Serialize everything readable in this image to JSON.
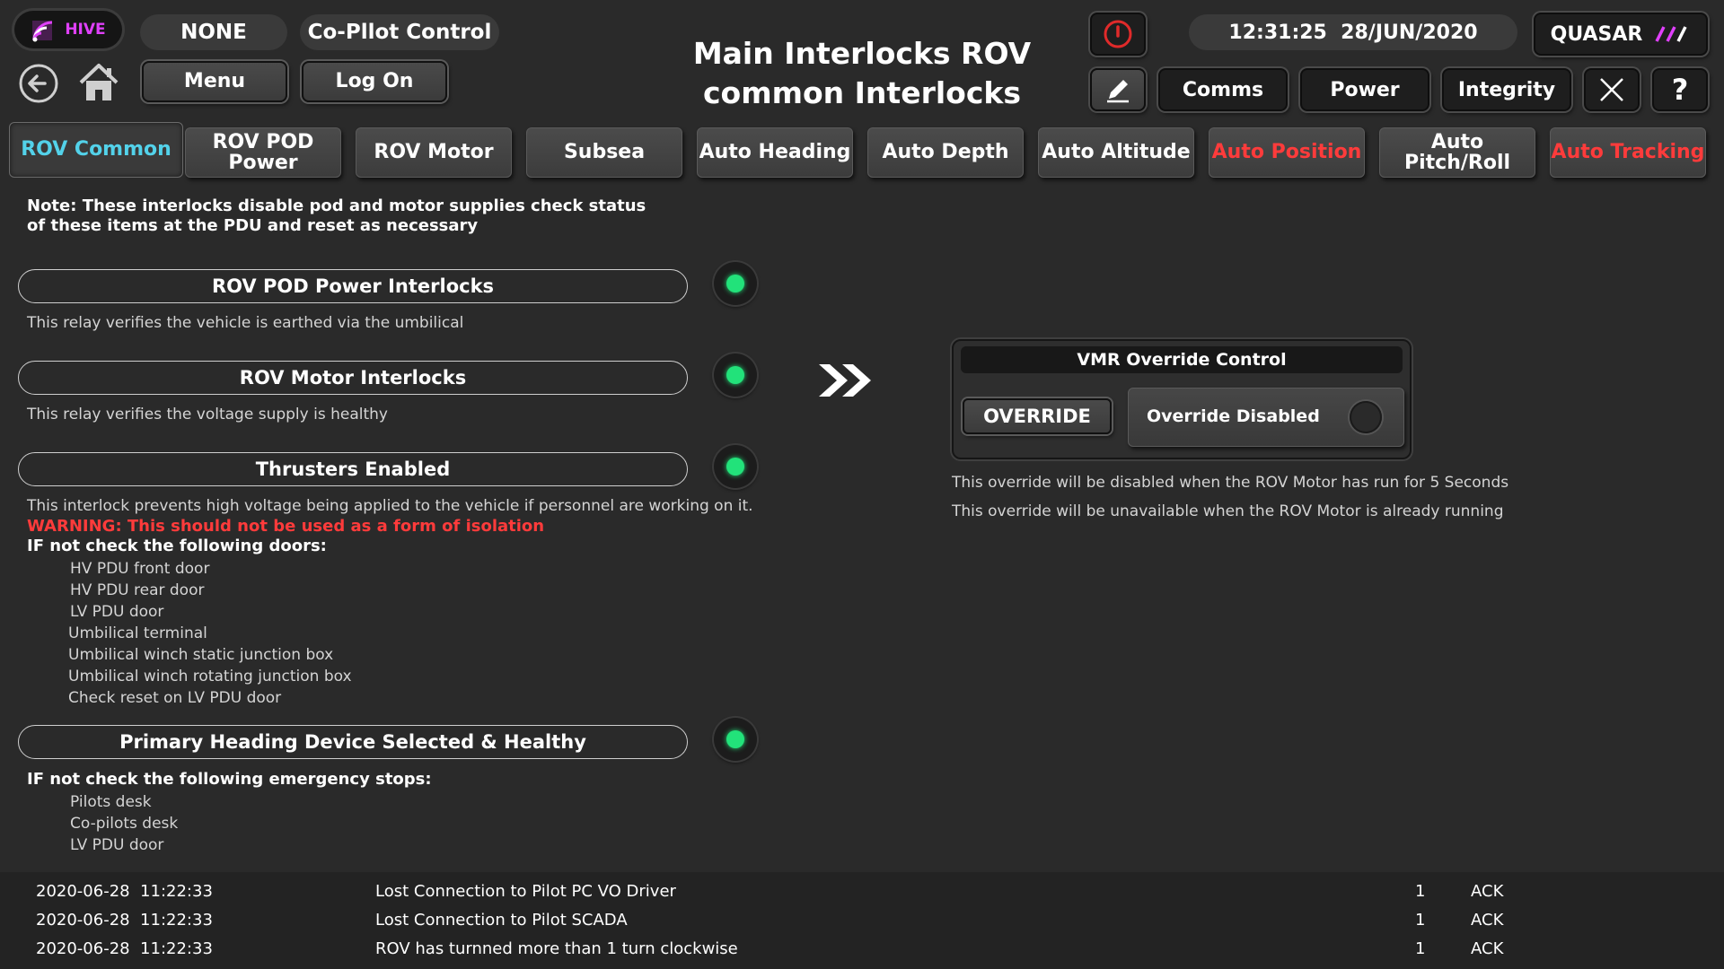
{
  "header": {
    "logo_text": "HIVE",
    "mode": "NONE",
    "control": "Co-Pllot Control",
    "menu_label": "Menu",
    "logon_label": "Log On",
    "title_line1": "Main Interlocks ROV",
    "title_line2": "common Interlocks",
    "clock": "12:31:25  28/JUN/2020",
    "vehicle": "QUASAR",
    "comms_label": "Comms",
    "power_label": "Power",
    "integrity_label": "Integrity",
    "help_label": "?"
  },
  "tabs": [
    {
      "label": "ROV Common",
      "state": "active"
    },
    {
      "label": "ROV POD Power",
      "state": "normal"
    },
    {
      "label": "ROV Motor",
      "state": "normal"
    },
    {
      "label": "Subsea",
      "state": "normal"
    },
    {
      "label": "Auto Heading",
      "state": "normal"
    },
    {
      "label": "Auto Depth",
      "state": "normal"
    },
    {
      "label": "Auto Altitude",
      "state": "normal"
    },
    {
      "label": "Auto Position",
      "state": "alarm"
    },
    {
      "label": "Auto Pitch/Roll",
      "state": "normal"
    },
    {
      "label": "Auto Tracking",
      "state": "alarm"
    }
  ],
  "note": {
    "line1": "Note: These interlocks disable pod and motor supplies check status",
    "line2": "of these items at the PDU and reset as necessary"
  },
  "interlocks": {
    "pod_power": {
      "title": "ROV POD Power Interlocks",
      "desc": "This relay verifies the vehicle is earthed via the umbilical"
    },
    "motor": {
      "title": "ROV Motor Interlocks",
      "desc": "This relay verifies the voltage supply is healthy"
    },
    "thrusters": {
      "title": "Thrusters Enabled",
      "desc": "This interlock prevents high voltage being applied to the vehicle if personnel are working on it.",
      "warning": "WARNING:  This should not be used as a form of isolation",
      "check_heading": "IF not check the following doors:",
      "items": [
        "HV PDU front door",
        "HV PDU rear door",
        "LV PDU door",
        "Umbilical terminal",
        "Umbilical winch static junction box",
        "Umbilical winch rotating junction box",
        "Check reset on LV PDU door"
      ]
    },
    "heading": {
      "title": "Primary Heading Device Selected & Healthy",
      "check_heading": "IF not check the following emergency stops:",
      "items": [
        "Pilots desk",
        "Co-pilots desk",
        "LV PDU door"
      ]
    }
  },
  "vmr": {
    "title": "VMR Override Control",
    "override_label": "OVERRIDE",
    "status": "Override Disabled",
    "note1": "This override will be disabled when the ROV Motor has run for 5 Seconds",
    "note2": "This override will be unavailable when the ROV Motor is already running"
  },
  "alarms": [
    {
      "time": "2020-06-28  11:22:33",
      "message": "Lost Connection to Pilot PC VO Driver",
      "count": "1",
      "ack": "ACK"
    },
    {
      "time": "2020-06-28  11:22:33",
      "message": "Lost Connection to Pilot SCADA",
      "count": "1",
      "ack": "ACK"
    },
    {
      "time": "2020-06-28  11:22:33",
      "message": "ROV has turnned more than 1 turn clockwise",
      "count": "1",
      "ack": "ACK"
    }
  ],
  "colors": {
    "accent_cyan": "#53d2ea",
    "status_green": "#22e27a",
    "alarm_red": "#ff3b3b",
    "logo_magenta": "#e040fb"
  }
}
